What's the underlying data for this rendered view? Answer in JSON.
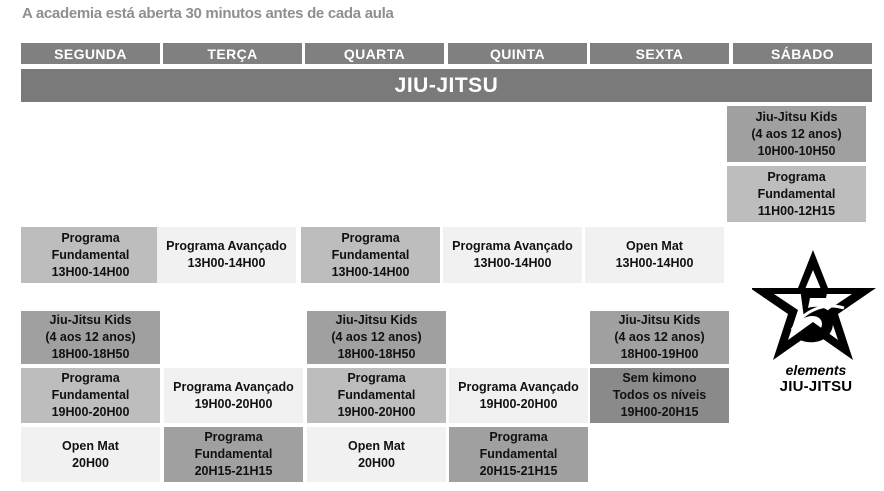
{
  "notice": "A academia está aberta 30 minutos antes de cada aula",
  "days": [
    "SEGUNDA",
    "TERÇA",
    "QUARTA",
    "QUINTA",
    "SEXTA",
    "SÁBADO"
  ],
  "banner": "JIU-JITSU",
  "colors": {
    "header": "#808080",
    "banner": "#7a7a7a",
    "cell_light": "#f1f1f1",
    "cell_mid": "#bdbdbd",
    "cell_dark": "#a0a0a0",
    "cell_darker": "#8a8a8a"
  },
  "schedule": {
    "segunda": [
      {
        "lines": [
          "Programa",
          "Fundamental",
          "13H00-14H00"
        ]
      },
      {
        "lines": [
          "Jiu-Jitsu Kids",
          "(4 aos 12 anos)",
          "18H00-18H50"
        ]
      },
      {
        "lines": [
          "Programa",
          "Fundamental",
          "19H00-20H00"
        ]
      },
      {
        "lines": [
          "Open Mat",
          "20H00"
        ]
      }
    ],
    "terca": [
      {
        "lines": [
          "Programa Avançado",
          "13H00-14H00"
        ]
      },
      {
        "lines": [
          "Programa Avançado",
          "19H00-20H00"
        ]
      },
      {
        "lines": [
          "Programa",
          "Fundamental",
          "20H15-21H15"
        ]
      }
    ],
    "quarta": [
      {
        "lines": [
          "Programa",
          "Fundamental",
          "13H00-14H00"
        ]
      },
      {
        "lines": [
          "Jiu-Jitsu Kids",
          "(4 aos 12 anos)",
          "18H00-18H50"
        ]
      },
      {
        "lines": [
          "Programa",
          "Fundamental",
          "19H00-20H00"
        ]
      },
      {
        "lines": [
          "Open Mat",
          "20H00"
        ]
      }
    ],
    "quinta": [
      {
        "lines": [
          "Programa Avançado",
          "13H00-14H00"
        ]
      },
      {
        "lines": [
          "Programa Avançado",
          "19H00-20H00"
        ]
      },
      {
        "lines": [
          "Programa",
          "Fundamental",
          "20H15-21H15"
        ]
      }
    ],
    "sexta": [
      {
        "lines": [
          "Open Mat",
          "13H00-14H00"
        ]
      },
      {
        "lines": [
          "Jiu-Jitsu Kids",
          "(4 aos 12 anos)",
          "18H00-19H00"
        ]
      },
      {
        "lines": [
          "Sem kimono",
          "Todos os níveis",
          "19H00-20H15"
        ]
      }
    ],
    "sabado": [
      {
        "lines": [
          "Jiu-Jitsu Kids",
          "(4 aos 12 anos)",
          "10H00-10H50"
        ]
      },
      {
        "lines": [
          "Programa",
          "Fundamental",
          "11H00-12H15"
        ]
      }
    ]
  },
  "logo": {
    "icon": "star-5-logo-icon",
    "word1": "elements",
    "word2": "JIU-JITSU"
  }
}
